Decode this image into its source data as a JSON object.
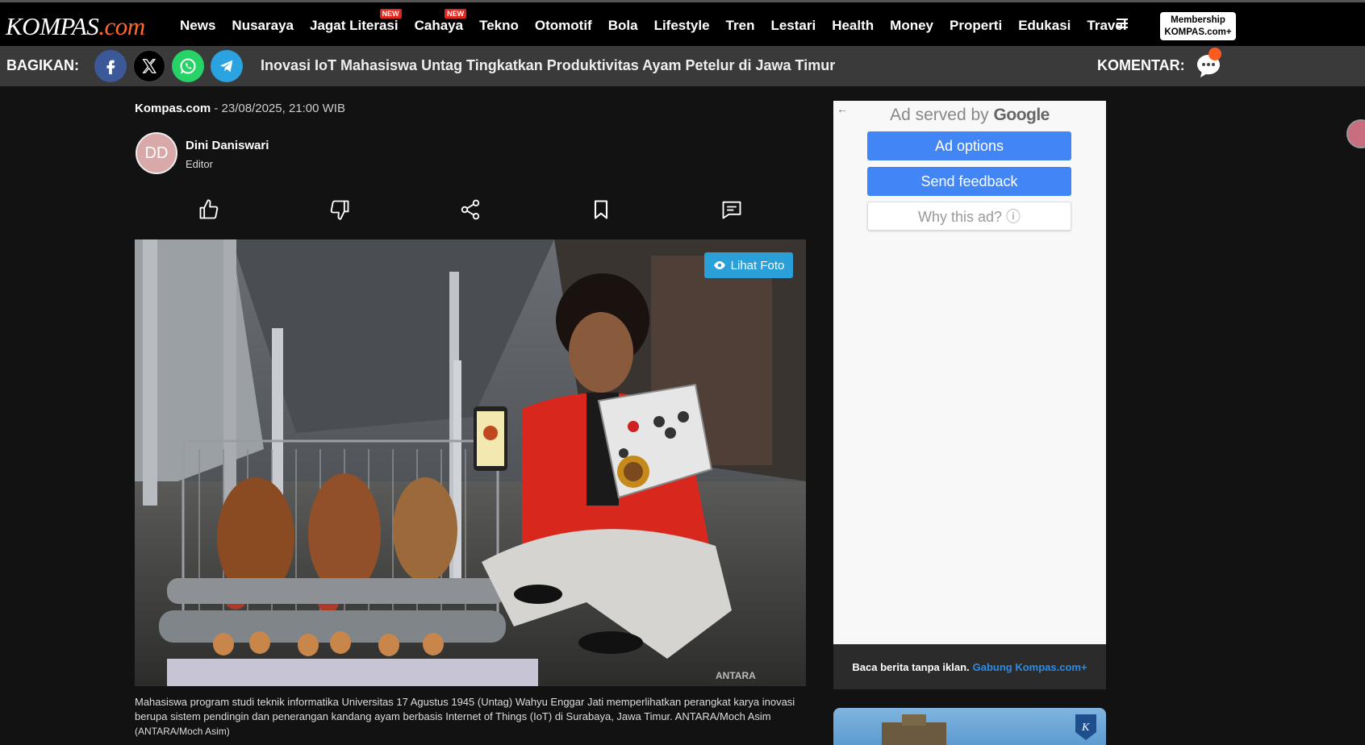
{
  "header": {
    "logo_main": "KOMPAS",
    "logo_suffix": ".com",
    "nav": [
      {
        "label": "News",
        "badge": ""
      },
      {
        "label": "Nusaraya",
        "badge": ""
      },
      {
        "label": "Jagat Literasi",
        "badge": "NEW"
      },
      {
        "label": "Cahaya",
        "badge": "NEW"
      },
      {
        "label": "Tekno",
        "badge": ""
      },
      {
        "label": "Otomotif",
        "badge": ""
      },
      {
        "label": "Bola",
        "badge": ""
      },
      {
        "label": "Lifestyle",
        "badge": ""
      },
      {
        "label": "Tren",
        "badge": ""
      },
      {
        "label": "Lestari",
        "badge": ""
      },
      {
        "label": "Health",
        "badge": ""
      },
      {
        "label": "Money",
        "badge": ""
      },
      {
        "label": "Properti",
        "badge": ""
      },
      {
        "label": "Edukasi",
        "badge": ""
      },
      {
        "label": "Travel",
        "badge": ""
      }
    ],
    "menu_icon": "hamburger-icon",
    "membership_line1": "Membership",
    "membership_line2": "KOMPAS.com+"
  },
  "sharebar": {
    "label": "BAGIKAN:",
    "headline": "Inovasi IoT Mahasiswa Untag Tingkatkan Produktivitas Ayam Petelur di Jawa Timur",
    "comment_label": "KOMENTAR:",
    "colors": {
      "facebook": "#3b5998",
      "x": "#000000",
      "whatsapp": "#25d366",
      "telegram": "#2aa3e0"
    }
  },
  "article": {
    "source": "Kompas.com",
    "date": " - 23/08/2025, 21:00 WIB",
    "author_initials": "DD",
    "author_name": "Dini Daniswari",
    "author_role": "Editor",
    "photo_button": "Lihat Foto",
    "photo_watermark": "ANTARA",
    "caption": "Mahasiswa program studi teknik informatika Universitas 17 Agustus 1945 (Untag) Wahyu Enggar Jati memperlihatkan perangkat karya inovasi berupa sistem pendingin dan penerangan kandang ayam berbasis Internet of Things (IoT) di Surabaya, Jawa Timur. ANTARA/Moch Asim",
    "credit": "(ANTARA/Moch Asim)"
  },
  "ad": {
    "served_by": "Ad served by",
    "google": "Google",
    "options": "Ad options",
    "feedback": "Send feedback",
    "why": "Why this ad? ⓘ",
    "footer_text": "Baca berita tanpa iklan.",
    "footer_link": "Gabung Kompas.com+"
  }
}
